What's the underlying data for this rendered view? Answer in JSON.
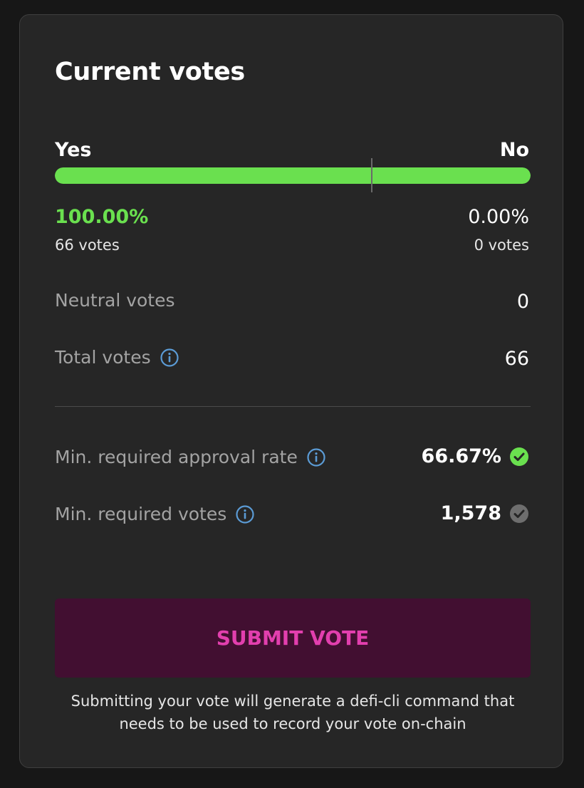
{
  "card": {
    "title": "Current votes",
    "yes": {
      "label": "Yes",
      "percent": "100.00%",
      "votes": "66 votes",
      "bar_fraction": 1.0
    },
    "no": {
      "label": "No",
      "percent": "0.00%",
      "votes": "0 votes"
    },
    "threshold_fraction": 0.6667,
    "rows": {
      "neutral": {
        "label": "Neutral votes",
        "value": "0"
      },
      "total": {
        "label": "Total votes",
        "value": "66",
        "icon": "info-icon"
      },
      "approval": {
        "label": "Min. required approval rate",
        "value": "66.67%",
        "icon": "info-icon",
        "status": "met",
        "status_icon": "check-circle-icon"
      },
      "min_votes": {
        "label": "Min. required votes",
        "value": "1,578",
        "icon": "info-icon",
        "status": "not-met",
        "status_icon": "check-circle-icon"
      }
    },
    "submit_label": "SUBMIT VOTE",
    "note": "Submitting your vote will generate a defi-cli command that needs to be used to record your vote on-chain"
  },
  "colors": {
    "background": "#171717",
    "card": "#262626",
    "yes_green": "#6ae04f",
    "info_blue": "#5b9bd5",
    "check_grey": "#6e6e6e",
    "submit_bg": "#420f31",
    "submit_text": "#e23fae"
  }
}
